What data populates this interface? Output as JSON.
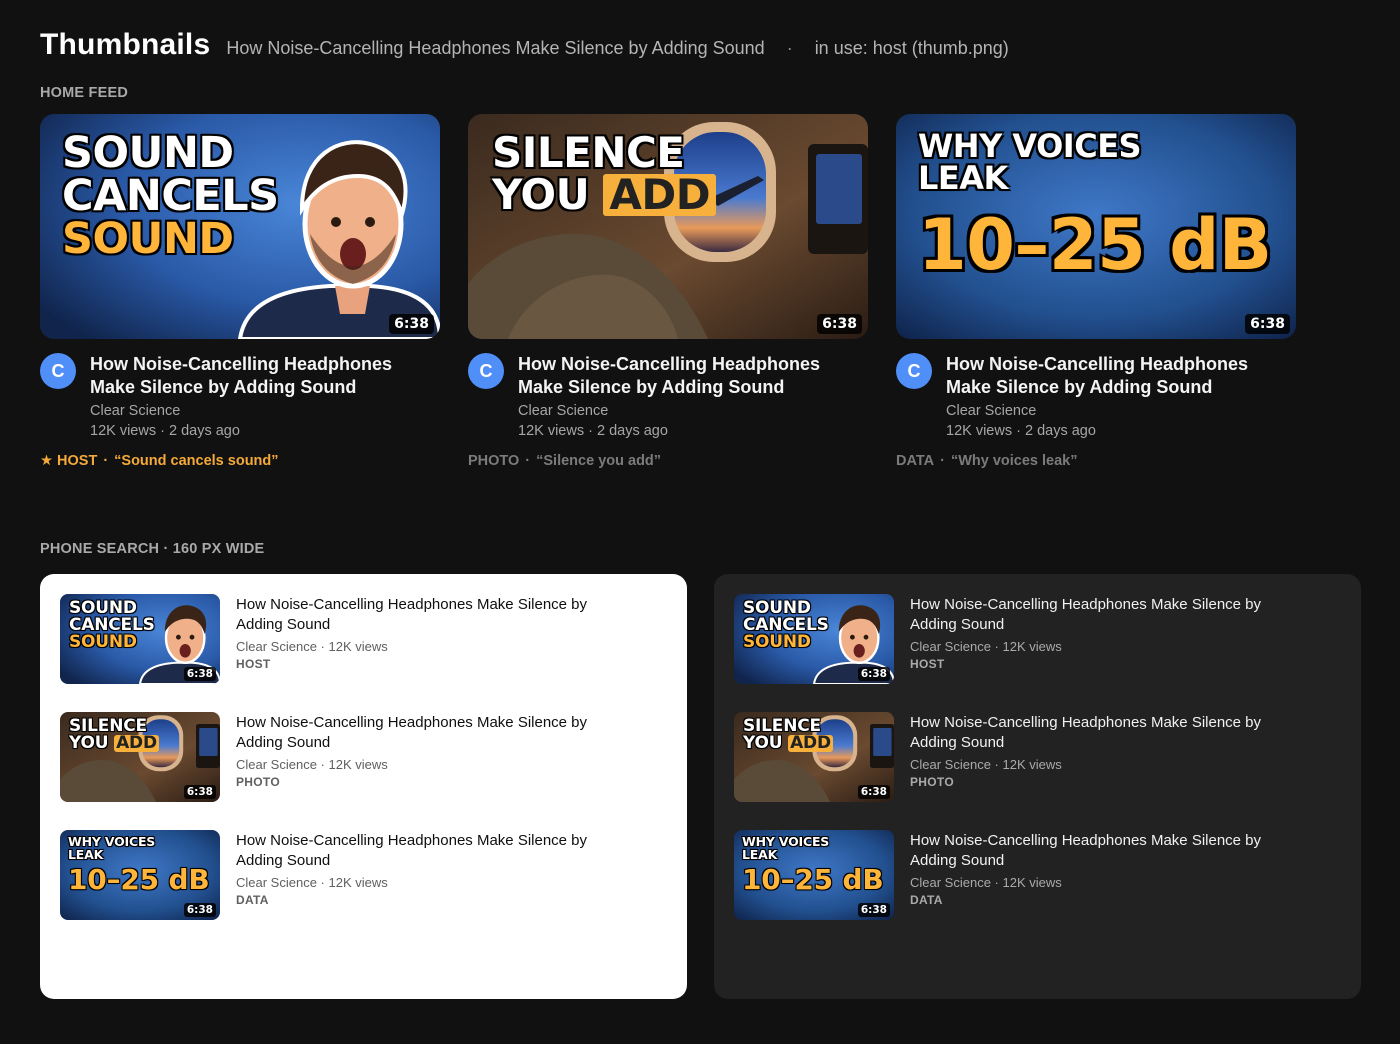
{
  "header": {
    "title": "Thumbnails",
    "subtitle": "How Noise-Cancelling Headphones Make Silence by Adding Sound",
    "separator": "·",
    "in_use": "in use: host (thumb.png)"
  },
  "sections": {
    "home_feed": "HOME FEED",
    "phone_search": "PHONE SEARCH · 160 PX WIDE"
  },
  "video": {
    "title": "How Noise-Cancelling Headphones Make Silence by Adding Sound",
    "channel": "Clear Science",
    "avatar_letter": "C",
    "stats": "12K views · 2 days ago",
    "search_sub": "Clear Science · 12K views",
    "duration": "6:38"
  },
  "thumbs": {
    "host": {
      "line1": "SOUND",
      "line2": "CANCELS",
      "line3": "SOUND"
    },
    "photo": {
      "line1": "SILENCE",
      "line2a": "YOU",
      "line2b": "ADD"
    },
    "data": {
      "line1": "WHY VOICES",
      "line2": "LEAK",
      "big": "10–25 dB"
    }
  },
  "variants": [
    {
      "tag": "HOST",
      "star": "★",
      "quote": "“Sound cancels sound”",
      "accent": "#f4a93a"
    },
    {
      "tag": "PHOTO",
      "quote": "“Silence you add”"
    },
    {
      "tag": "DATA",
      "quote": "“Why voices leak”"
    }
  ],
  "colors": {
    "background": "#111111",
    "accent_orange": "#ffb43a",
    "avatar_blue": "#4f8ff7",
    "thumb_blue": "#2a5aa8"
  },
  "icons": [
    "star-icon"
  ]
}
